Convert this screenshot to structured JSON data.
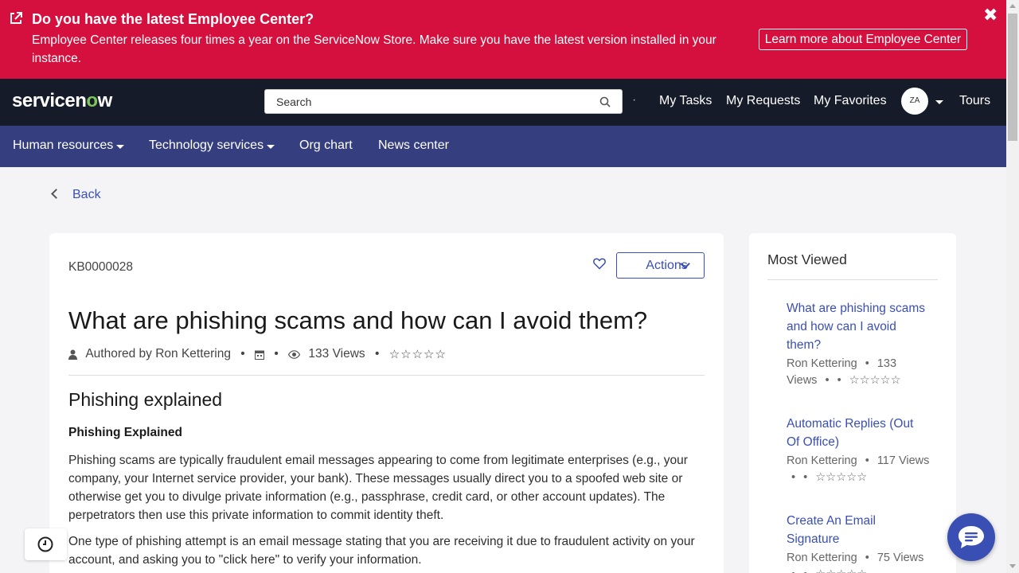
{
  "banner": {
    "title": "Do you have the latest Employee Center?",
    "text": "Employee Center releases four times a year on the ServiceNow Store. Make sure you have the latest version installed in your instance.",
    "button_label": "Learn more about Employee Center",
    "close_glyph": "✖",
    "background": "#d6103e"
  },
  "header": {
    "logo_pre": "servicen",
    "logo_o": "o",
    "logo_post": "w",
    "search_placeholder": "Search",
    "dot": "·",
    "nav": [
      "My Tasks",
      "My Requests",
      "My Favorites"
    ],
    "avatar_initials": "ZA",
    "tours_label": "Tours",
    "background": "#161b2a"
  },
  "subnav": {
    "items": [
      "Human resources",
      "Technology services",
      "Org chart",
      "News center"
    ],
    "background": "#353e7f"
  },
  "back_label": "Back",
  "article": {
    "number": "KB0000028",
    "actions_label": "Actions",
    "title": "What are phishing scams and how can I avoid them?",
    "author": "Authored by Ron Kettering",
    "bullet": "•",
    "views": "133 Views",
    "stars": "☆☆☆☆☆",
    "heading": "Phishing explained",
    "subheading": "Phishing Explained",
    "paragraphs": [
      "Phishing scams are typically fraudulent email messages appearing to come from legitimate enterprises (e.g., your company, your Internet service provider, your bank). These messages usually direct you to a spoofed web site or otherwise get you to divulge private information (e.g., passphrase, credit card, or other account updates). The perpetrators then use this private information to commit identity theft.",
      "One type of phishing attempt is an email message stating that you are receiving it due to fraudulent activity on your account, and asking you to \"click here\" to verify your information."
    ]
  },
  "most_viewed": {
    "title": "Most Viewed",
    "items": [
      {
        "title": "What are phishing scams and how can I avoid them?",
        "author": "Ron Kettering",
        "bullet": "•",
        "views": "133",
        "views_label": "Views",
        "stars": "☆☆☆☆☆"
      },
      {
        "title": "Automatic Replies (Out Of Office)",
        "author": "Ron Kettering",
        "bullet": "•",
        "views": "117",
        "views_label": "Views",
        "stars": "☆☆☆☆☆"
      },
      {
        "title": "Create An Email Signature",
        "author": "Ron Kettering",
        "bullet": "•",
        "views": "75",
        "views_label": "Views",
        "stars": "☆☆☆☆☆"
      }
    ]
  },
  "colors": {
    "accent": "#3a4fb3",
    "logo_o": "#7ec55a"
  }
}
